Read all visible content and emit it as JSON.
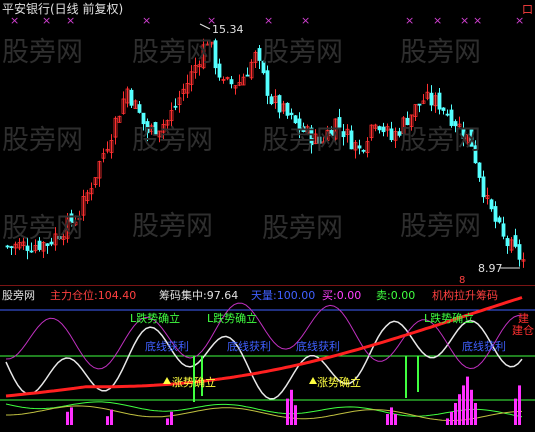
{
  "window": {
    "title": "平安银行(日线 前复权)",
    "corner_tag": "口"
  },
  "price_panel": {
    "high_label": "15.34",
    "low_label": "8.97",
    "pointer_marker": "8",
    "up_color": "#ff3030",
    "down_color": "#54ffff",
    "markers": "×",
    "marker_color": "#d040d0"
  },
  "indicator_bar": {
    "brand": "股旁网",
    "items": [
      {
        "label": "主力仓位:",
        "value": "104.40",
        "color": "#ff4040"
      },
      {
        "label": "筹码集中:",
        "value": "97.64",
        "color": "#e0e0e0"
      },
      {
        "label": "天量:",
        "value": "100.00",
        "color": "#4060ff"
      },
      {
        "label": "买:",
        "value": "0.00",
        "color": "#ff40ff"
      },
      {
        "label": "卖:",
        "value": "0.00",
        "color": "#40ff40"
      },
      {
        "label": "机构拉升筹码",
        "value": "",
        "color": "#ff4040"
      }
    ]
  },
  "indicator_panel": {
    "annotations": [
      {
        "text": "L跌势确立",
        "color": "#40ff40"
      },
      {
        "text": "L跌势确立",
        "color": "#40ff40"
      },
      {
        "text": "L跌势确立",
        "color": "#40ff40"
      },
      {
        "text": "底线获利",
        "color": "#4060ff"
      },
      {
        "text": "底线获利",
        "color": "#4060ff"
      },
      {
        "text": "底线获利",
        "color": "#4060ff"
      },
      {
        "text": "底线获利",
        "color": "#4060ff"
      },
      {
        "text": "涨势确立",
        "color": "#ffff40"
      },
      {
        "text": "涨势确立",
        "color": "#ffff40"
      },
      {
        "text": "建仓",
        "color": "#ff3030"
      },
      {
        "text": "建",
        "color": "#ff3030"
      }
    ]
  },
  "watermark": "股旁网"
}
